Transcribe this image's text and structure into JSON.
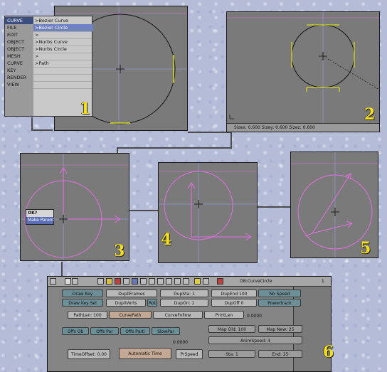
{
  "menu": {
    "items": [
      {
        "key": "CURVE",
        "val": ">Bezier Curve"
      },
      {
        "key": "FILE",
        "val": ">Bezier Circle"
      },
      {
        "key": "EDIT",
        "val": ">"
      },
      {
        "key": "OBJECT",
        "val": ">Nurbs Curve"
      },
      {
        "key": "OBJECT",
        "val": ">Nurbs Circle"
      },
      {
        "key": "MESH",
        "val": ">"
      },
      {
        "key": "CURVE",
        "val": ">Path"
      },
      {
        "key": "KEY",
        "val": ""
      },
      {
        "key": "RENDER",
        "val": ""
      },
      {
        "key": "VIEW",
        "val": ""
      }
    ]
  },
  "panel2": {
    "status": "Sizex: 0.600   Sizey: 0.600   Sizez: 0.600"
  },
  "panel3": {
    "popup_title": "OK?",
    "popup_item": "Make Parent"
  },
  "steps": [
    "1",
    "2",
    "3",
    "4",
    "5",
    "6"
  ],
  "anim": {
    "object_name": "OB:CurveCircle",
    "header_num": "1",
    "draw_key": "Draw Key",
    "dupli_frames": "DupliFrames",
    "dup_sta": "DupSta: 1",
    "dup_end": "DupEnd 100",
    "no_speed": "No Speed",
    "draw_key_sel": "Draw Key Sel",
    "dupli_verts": "DupliVerts",
    "rot": "Rot",
    "dup_on": "DupOn: 1",
    "dup_off": "DupOff 0",
    "powertrack": "Powertrack",
    "path_len": "PathLen: 100",
    "curve_path": "CurvePath",
    "curve_follow": "CurveFollow",
    "print_len": "PrintLen",
    "print_len_val": "0.0000",
    "offs_ob": "Offs Ob",
    "offs_par": "Offs Par",
    "offs_parti": "Offs Parti",
    "slow_par": "SlowPar",
    "map_old": "Map Old: 100",
    "map_new": "Map New: 25",
    "anim_speed": "AnimSpeed: 4",
    "sta": "Sta: 1",
    "end": "End: 25",
    "ctime_val": "0.0000",
    "time_offset": "TimeOffset: 0.00",
    "automatic_time": "Automatic Time",
    "pr_speed": "PrSpeed"
  },
  "colors": {
    "yellow": "#f4e020",
    "pink": "#e070e0",
    "handle": "#d8d820",
    "menu_header": "#3c4e80",
    "menu_selected": "#6f82c0"
  }
}
